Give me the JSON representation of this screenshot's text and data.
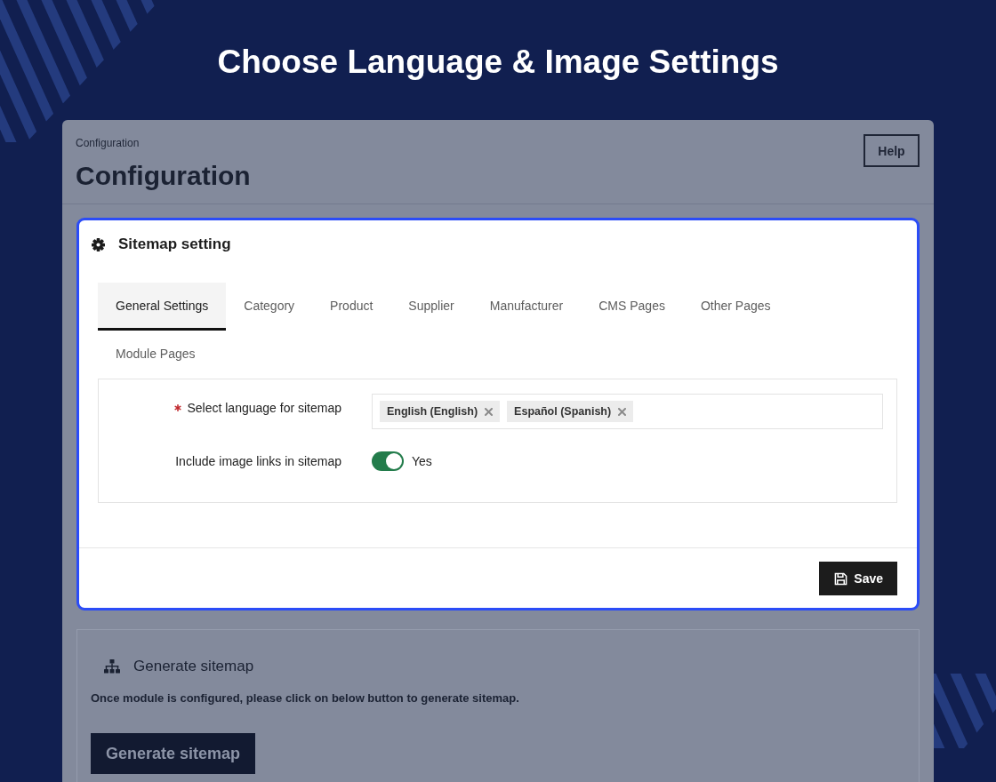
{
  "headline": "Choose Language & Image Settings",
  "page_header": {
    "breadcrumb": "Configuration",
    "title": "Configuration",
    "help_button": "Help"
  },
  "sitemap_setting": {
    "title": "Sitemap setting",
    "tabs": [
      {
        "label": "General Settings",
        "selected": true
      },
      {
        "label": "Category",
        "selected": false
      },
      {
        "label": "Product",
        "selected": false
      },
      {
        "label": "Supplier",
        "selected": false
      },
      {
        "label": "Manufacturer",
        "selected": false
      },
      {
        "label": "CMS Pages",
        "selected": false
      },
      {
        "label": "Other Pages",
        "selected": false
      },
      {
        "label": "Module Pages",
        "selected": false
      }
    ],
    "fields": [
      {
        "kind": "tags",
        "label": "Select language for sitemap",
        "required": true,
        "tags": [
          "English (English)",
          "Español (Spanish)"
        ]
      },
      {
        "kind": "toggle",
        "label": "Include image links in sitemap",
        "required": false,
        "on": true,
        "value": "Yes"
      }
    ],
    "save_button": "Save"
  },
  "generate_sitemap": {
    "title": "Generate sitemap",
    "description": "Once module is configured, please click on below button to generate sitemap.",
    "button": "Generate sitemap"
  }
}
